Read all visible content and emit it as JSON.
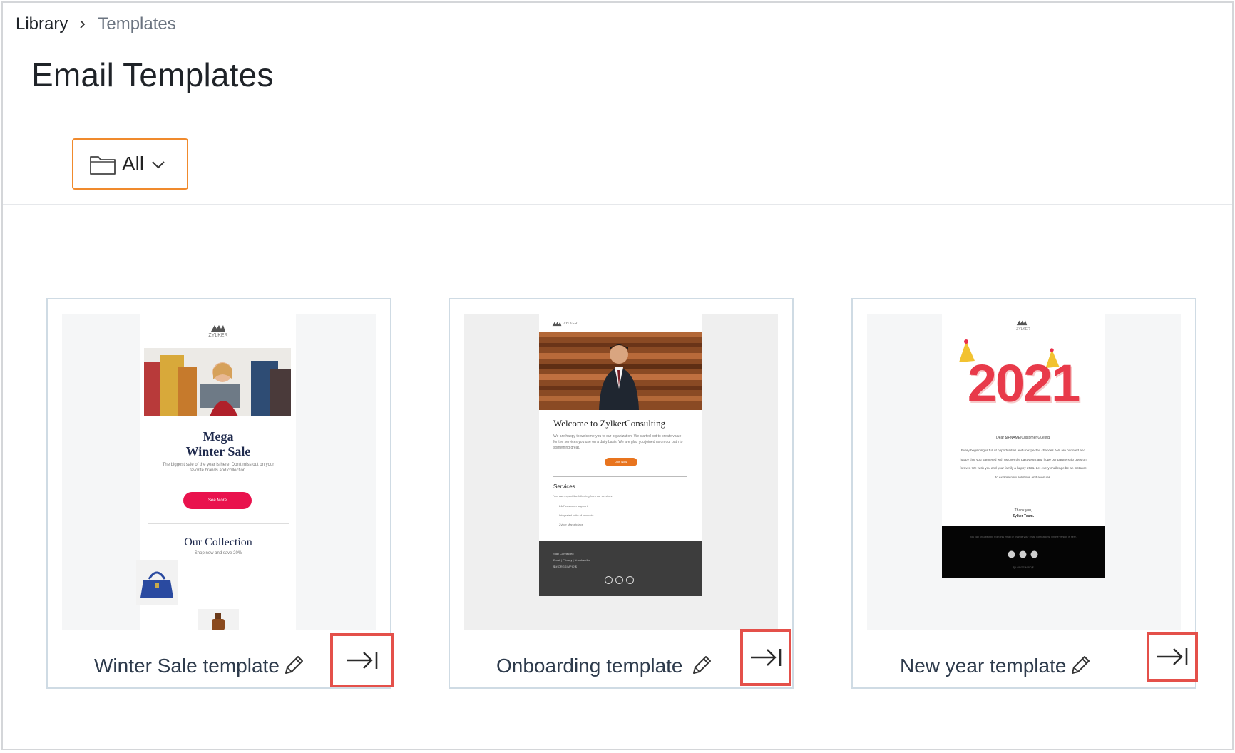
{
  "breadcrumb": {
    "root": "Library",
    "current": "Templates"
  },
  "page": {
    "title": "Email Templates"
  },
  "filter": {
    "folder_label": "All"
  },
  "colors": {
    "accent_orange": "#f08a2d",
    "highlight_red": "#e4504a",
    "sale_pink": "#e9124d",
    "cta_orange": "#e8741e"
  },
  "templates": [
    {
      "name": "Winter Sale template",
      "preview": {
        "brand": "ZYLKER",
        "headline_1": "Mega",
        "headline_2": "Winter Sale",
        "body": "The biggest sale of the year is here. Don't miss out on your favorite brands and collection.",
        "cta": "See More",
        "section": "Our Collection",
        "section_sub": "Shop now and save 20%"
      }
    },
    {
      "name": "Onboarding template",
      "preview": {
        "brand": "ZYLKER",
        "headline": "Welcome to ZylkerConsulting",
        "body": "We are happy to welcome you to our organization. We started out to create value for the services you use on a daily basis. We are glad you joined us on our path to something great.",
        "cta": "Join Now",
        "section": "Services",
        "section_intro": "You can expect the following from our services",
        "list": [
          "24/7 customer support",
          "Integrated suite of products",
          "Zylker Marketplace"
        ],
        "footer_1": "Stay Connected",
        "footer_2": "Email | Privacy | Unsubscribe",
        "footer_3": "$[# ORGSIMPID]$"
      }
    },
    {
      "name": "New year template",
      "preview": {
        "brand": "ZYLKER",
        "year": "2021",
        "greeting": "Dear $[FNAME|Customer|Guest]$",
        "body": "Every beginning is full of opportunities and unexpected chances. We are honored and happy that you partnered with us over the past years and hope our partnership goes on forever. We wish you and your family a happy 2021. Let every challenge be an instance to explore new solutions and avenues.",
        "thanks": "Thank you,",
        "signoff": "Zylker Team.",
        "footer_1": "You can unsubscribe from this email or change your email notifications. Online version is here.",
        "footer_2": "$[# ORGSIMPID]$"
      }
    }
  ]
}
